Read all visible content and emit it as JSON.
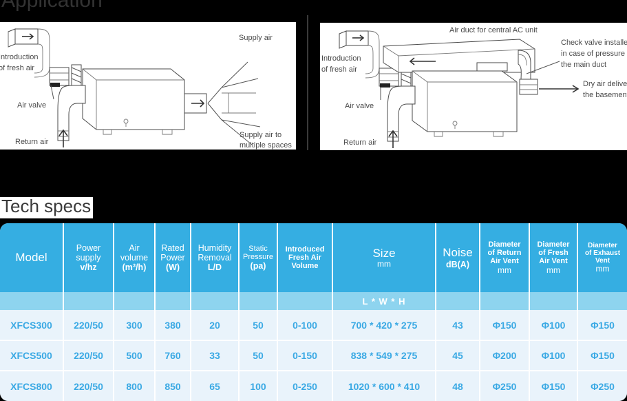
{
  "page": {
    "title": "Application",
    "background_color": "#000000"
  },
  "tech_specs": {
    "heading": "Tech specs"
  },
  "diagrams": {
    "left": {
      "name": "fresh-air-supply-to-multiple-spaces",
      "labels": {
        "intro_fresh_air_1": "Introduction",
        "intro_fresh_air_2": "of fresh air",
        "air_valve": "Air valve",
        "return_air": "Return air",
        "supply_air": "Supply air",
        "supply_air_multiple_1": "Supply air to",
        "supply_air_multiple_2": "multiple spaces"
      }
    },
    "right": {
      "name": "fresh-air-with-central-ac-duct",
      "labels": {
        "air_duct_central_ac": "Air duct for central AC unit",
        "intro_fresh_air_1": "Introduction",
        "intro_fresh_air_2": "of fresh air",
        "air_valve": "Air valve",
        "return_air": "Return air",
        "check_valve_1": "Check valve installed",
        "check_valve_2": "in case of pressure in",
        "check_valve_3": "the main duct",
        "dry_air_1": "Dry air delivered to",
        "dry_air_2": "the basement"
      }
    }
  },
  "table": {
    "colors": {
      "header_blue": "#35aee2",
      "subheader_blue": "#8ed4ef",
      "row_bg": "#e9f3fb",
      "value_text": "#3aa9e4",
      "separator": "#ffffff"
    },
    "headers": [
      {
        "id": "model",
        "line1": "Model",
        "line2": "",
        "line3": ""
      },
      {
        "id": "power-supply",
        "line1": "Power",
        "line2": "supply",
        "line3": "v/hz"
      },
      {
        "id": "air-volume",
        "line1": "Air",
        "line2": "volume",
        "line3": "(m³/h)"
      },
      {
        "id": "rated-power",
        "line1": "Rated",
        "line2": "Power",
        "line3": "(W)"
      },
      {
        "id": "humidity-removal",
        "line1": "Humidity",
        "line2": "Removal",
        "line3": "L/D"
      },
      {
        "id": "static-pressure",
        "line1": "Static",
        "line2": "Pressure",
        "line3": "(pa)"
      },
      {
        "id": "introduced-fresh-air-volume",
        "line1": "Introduced",
        "line2": "Fresh Air",
        "line3": "Volume"
      },
      {
        "id": "size",
        "line1": "Size",
        "line2": "mm",
        "line3": ""
      },
      {
        "id": "noise",
        "line1": "Noise",
        "line2": "dB(A)",
        "line3": ""
      },
      {
        "id": "diameter-return-air-vent",
        "line1": "Diameter",
        "line2": "of Return",
        "line3": "Air Vent",
        "line4": "mm"
      },
      {
        "id": "diameter-fresh-air-vent",
        "line1": "Diameter",
        "line2": "of Fresh",
        "line3": "Air Vent",
        "line4": "mm"
      },
      {
        "id": "diameter-exhaust-vent",
        "line1": "Diameter",
        "line2": "of Exhaust",
        "line3": "Vent",
        "line4": "mm"
      }
    ],
    "subheader": {
      "size_formula": "L  *  W  *  H"
    },
    "rows": [
      {
        "model": "XFCS300",
        "power_supply": "220/50",
        "air_volume": "300",
        "rated_power": "380",
        "humidity_removal": "20",
        "static_pressure": "50",
        "introduced_fresh_air_volume": "0-100",
        "size": "700  *  420  *  275",
        "noise": "43",
        "diameter_return_air_vent": "Φ150",
        "diameter_fresh_air_vent": "Φ100",
        "diameter_exhaust_vent": "Φ150"
      },
      {
        "model": "XFCS500",
        "power_supply": "220/50",
        "air_volume": "500",
        "rated_power": "760",
        "humidity_removal": "33",
        "static_pressure": "50",
        "introduced_fresh_air_volume": "0-150",
        "size": "838  *  549  *  275",
        "noise": "45",
        "diameter_return_air_vent": "Φ200",
        "diameter_fresh_air_vent": "Φ100",
        "diameter_exhaust_vent": "Φ150"
      },
      {
        "model": "XFCS800",
        "power_supply": "220/50",
        "air_volume": "800",
        "rated_power": "850",
        "humidity_removal": "65",
        "static_pressure": "100",
        "introduced_fresh_air_volume": "0-250",
        "size": "1020  *  600  *  410",
        "noise": "48",
        "diameter_return_air_vent": "Φ250",
        "diameter_fresh_air_vent": "Φ150",
        "diameter_exhaust_vent": "Φ250"
      }
    ]
  }
}
